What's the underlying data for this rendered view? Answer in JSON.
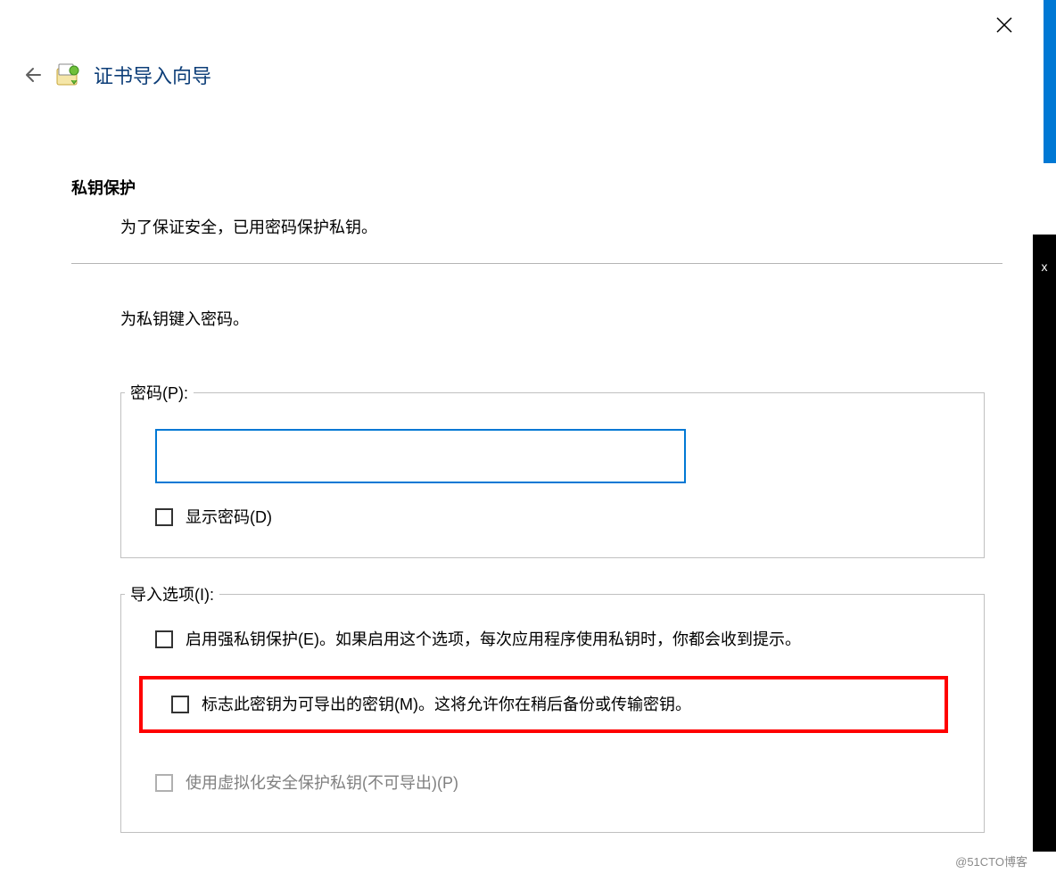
{
  "close_label": "×",
  "wizard_title": "证书导入向导",
  "side_x": "x",
  "section": {
    "title": "私钥保护",
    "subtitle": "为了保证安全，已用密码保护私钥。",
    "instruction": "为私钥键入密码。"
  },
  "password_group": {
    "legend": "密码(P):",
    "value": "",
    "show_password_label": "显示密码(D)"
  },
  "import_options": {
    "legend": "导入选项(I):",
    "opt_strong_protection": "启用强私钥保护(E)。如果启用这个选项，每次应用程序使用私钥时，你都会收到提示。",
    "opt_exportable": "标志此密钥为可导出的密钥(M)。这将允许你在稍后备份或传输密钥。",
    "opt_virtualized": "使用虚拟化安全保护私钥(不可导出)(P)"
  },
  "watermark": "@51CTO博客"
}
